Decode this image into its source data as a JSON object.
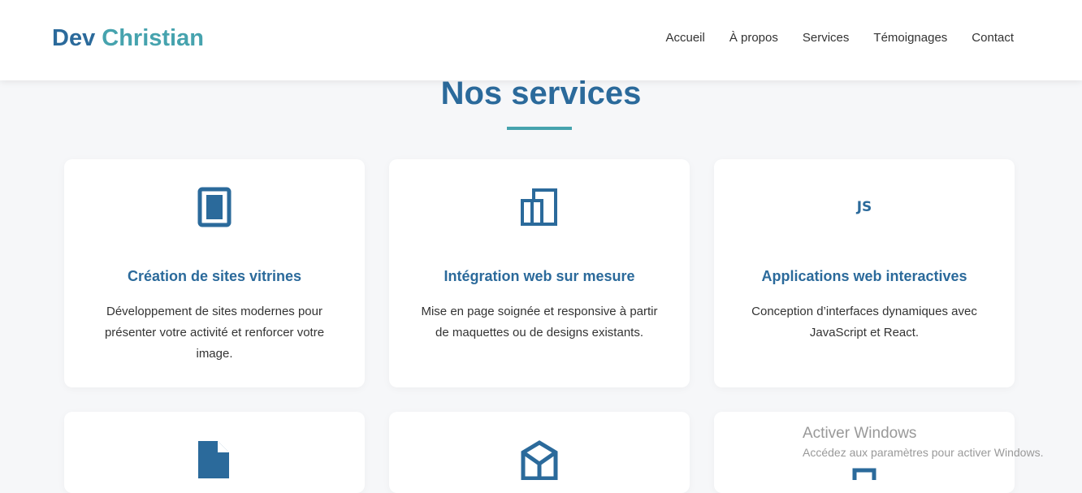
{
  "header": {
    "logo_first": "Dev",
    "logo_second": "Christian",
    "nav": [
      "Accueil",
      "À propos",
      "Services",
      "Témoignages",
      "Contact"
    ]
  },
  "section": {
    "title": "Nos services"
  },
  "services": [
    {
      "icon": "tablet-icon",
      "title": "Création de sites vitrines",
      "description": "Développement de sites modernes pour présenter votre activité et renforcer votre image."
    },
    {
      "icon": "buildings-icon",
      "title": "Intégration web sur mesure",
      "description": "Mise en page soignée et responsive à partir de maquettes ou de designs existants."
    },
    {
      "icon": "js-icon",
      "icon_text": "JS",
      "title": "Applications web interactives",
      "description": "Conception d’interfaces dynamiques avec JavaScript et React."
    }
  ],
  "watermark": {
    "title": "Activer Windows",
    "subtitle": "Accédez aux paramètres pour activer Windows."
  },
  "colors": {
    "primary": "#2b6a9b",
    "accent": "#46a3ae"
  }
}
